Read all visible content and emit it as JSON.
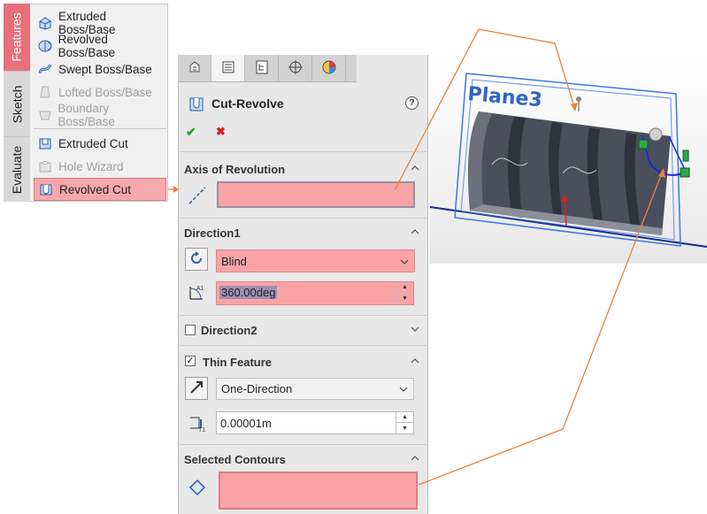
{
  "ribbon": {
    "vertical_tabs": [
      "Features",
      "Sketch",
      "Evaluate"
    ],
    "items": [
      {
        "label": "Extruded Boss/Base",
        "icon": "extruded-boss-icon",
        "disabled": false
      },
      {
        "label": "Revolved Boss/Base",
        "icon": "revolved-boss-icon",
        "disabled": false
      },
      {
        "label": "Swept Boss/Base",
        "icon": "swept-boss-icon",
        "disabled": false
      },
      {
        "label": "Lofted Boss/Base",
        "icon": "lofted-boss-icon",
        "disabled": true
      },
      {
        "label": "Boundary Boss/Base",
        "icon": "boundary-boss-icon",
        "disabled": true
      },
      {
        "label": "Extruded Cut",
        "icon": "extruded-cut-icon",
        "disabled": false
      },
      {
        "label": "Hole Wizard",
        "icon": "hole-wizard-icon",
        "disabled": true
      },
      {
        "label": "Revolved Cut",
        "icon": "revolved-cut-icon",
        "disabled": false,
        "selected": true
      }
    ]
  },
  "property_manager": {
    "tabs": [
      "feature-manager-icon",
      "property-manager-icon",
      "configuration-manager-icon",
      "dimxpert-icon",
      "display-manager-icon"
    ],
    "title": "Cut-Revolve",
    "ok_symbol": "✔",
    "cancel_symbol": "✖",
    "help_symbol": "?",
    "axis_section": {
      "label": "Axis of Revolution",
      "value": ""
    },
    "direction1": {
      "label": "Direction1",
      "end_condition": "Blind",
      "angle": "360.00deg"
    },
    "direction2": {
      "label": "Direction2",
      "checked": false
    },
    "thin_feature": {
      "label": "Thin Feature",
      "checked": true,
      "type": "One-Direction",
      "thickness": "0.00001m"
    },
    "selected_contours": {
      "label": "Selected Contours",
      "value": ""
    }
  },
  "viewport": {
    "plane_label": "Plane3",
    "colors": {
      "plane": "#3a78e8",
      "callout": "#e8823a",
      "model": "#4a4f5c",
      "sketch": "#1a2ad0",
      "highlight": "#f9a3a7"
    }
  }
}
